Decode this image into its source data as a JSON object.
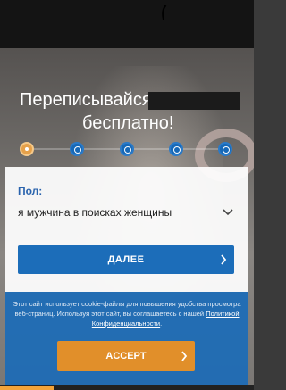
{
  "headline": {
    "line1": "Переписывайся",
    "line2": "бесплатно!"
  },
  "steps": {
    "count": 5,
    "active_index": 0
  },
  "form": {
    "gender_label": "Пол:",
    "gender_select_value": "я мужчина в поисках женщины",
    "next_button": "ДАЛЕЕ"
  },
  "cookie": {
    "text_before": "Этот сайт использует cookie-файлы для повышения удобства просмотра веб-страниц. Используя этот сайт, вы соглашаетесь с нашей ",
    "policy_link": "Политикой Конфиденциальности",
    "text_after": ".",
    "accept_button": "ACCEPT"
  },
  "colors": {
    "primary": "#1c6db9",
    "accent": "#e18f2a",
    "label": "#2a63ad"
  },
  "icons": {
    "select_chevron": "chevron-down-icon",
    "button_arrow": "chevron-right-icon"
  }
}
